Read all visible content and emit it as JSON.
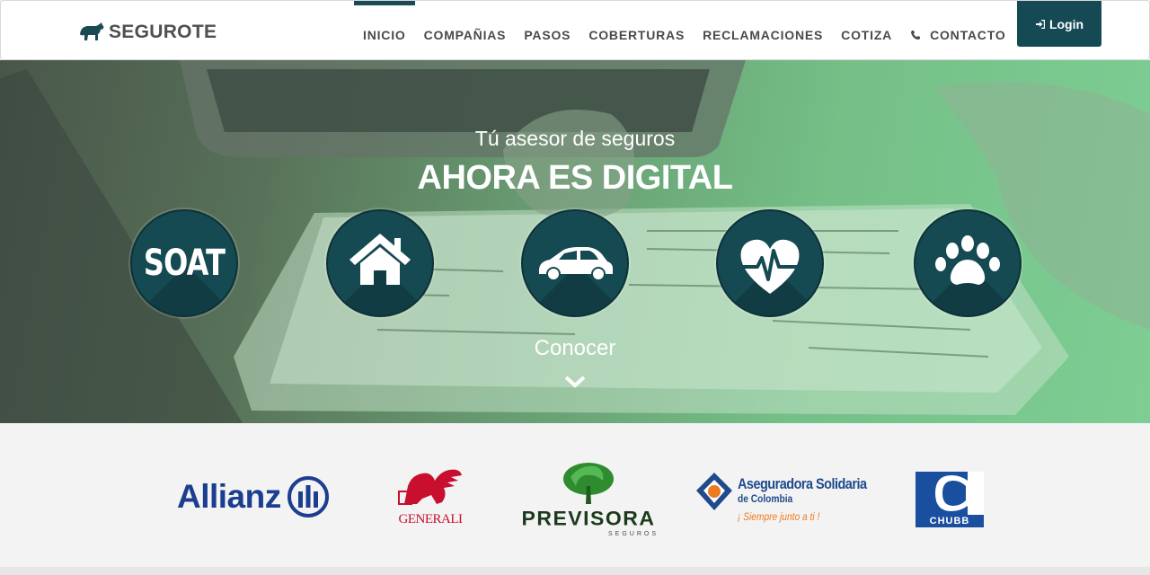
{
  "brand": {
    "name": "SEGUROTE",
    "icon": "bull-icon"
  },
  "nav": {
    "items": [
      {
        "label": "INICIO",
        "active": true
      },
      {
        "label": "COMPAÑIAS",
        "active": false
      },
      {
        "label": "PASOS",
        "active": false
      },
      {
        "label": "COBERTURAS",
        "active": false
      },
      {
        "label": "RECLAMACIONES",
        "active": false
      },
      {
        "label": "COTIZA",
        "active": false
      },
      {
        "label": "CONTACTO",
        "active": false,
        "icon": "phone-icon"
      }
    ],
    "login_label": "Login",
    "login_icon": "sign-in-icon"
  },
  "hero": {
    "subtitle": "Tú asesor de seguros",
    "title": "AHORA ES DIGITAL",
    "services": [
      {
        "name": "SOAT",
        "icon": "soat-text"
      },
      {
        "name": "Hogar",
        "icon": "house-icon"
      },
      {
        "name": "Auto",
        "icon": "car-icon"
      },
      {
        "name": "Salud",
        "icon": "heart-pulse-icon"
      },
      {
        "name": "Mascotas",
        "icon": "paw-icon"
      }
    ],
    "cta_label": "Conocer",
    "cta_icon": "chevron-down-icon"
  },
  "partners": {
    "logos": [
      {
        "name": "Allianz"
      },
      {
        "name": "GENERALI"
      },
      {
        "name": "PREVISORA",
        "tagline": "SEGUROS"
      },
      {
        "name": "Aseguradora Solidaria",
        "line2": "de Colombia",
        "tagline": "¡ Siempre junto a ti !"
      },
      {
        "name": "CHUBB"
      }
    ]
  },
  "colors": {
    "primary": "#154a55",
    "nav_text": "#4a4a4a",
    "allianz": "#1c3e8f",
    "generali": "#c8102e",
    "previsora": "#2e8b2e",
    "solidaria": "#1f4a8c",
    "chubb": "#1a4fa0"
  }
}
